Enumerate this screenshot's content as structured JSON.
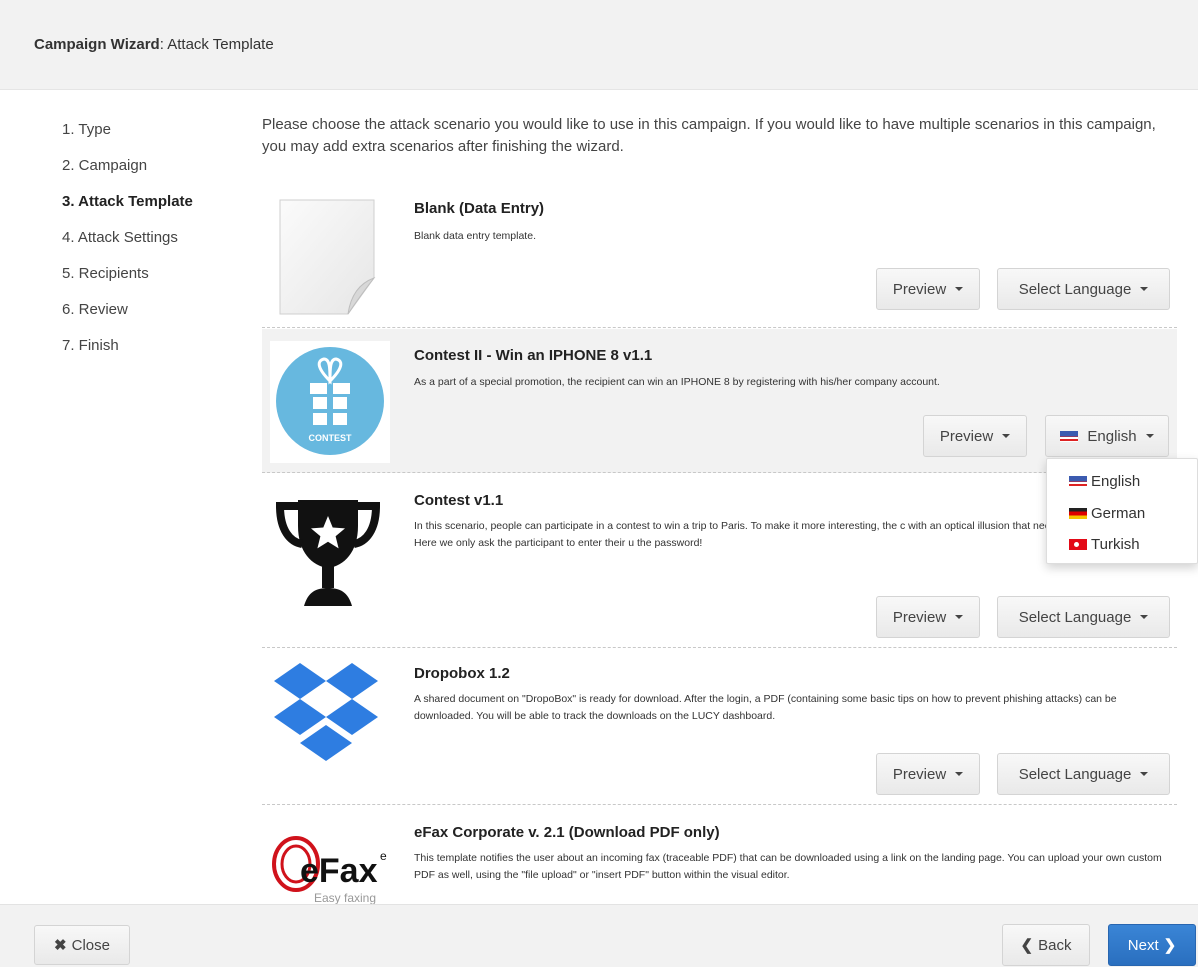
{
  "header": {
    "title_bold": "Campaign Wizard",
    "title_rest": ": Attack Template"
  },
  "steps": [
    {
      "label": "1. Type"
    },
    {
      "label": "2. Campaign"
    },
    {
      "label": "3. Attack Template",
      "active": true
    },
    {
      "label": "4. Attack Settings"
    },
    {
      "label": "5. Recipients"
    },
    {
      "label": "6. Review"
    },
    {
      "label": "7. Finish"
    }
  ],
  "intro": "Please choose the attack scenario you would like to use in this campaign. If you would like to have multiple scenarios in this campaign, you may add extra scenarios after finishing the wizard.",
  "templates": [
    {
      "name": "Blank (Data Entry)",
      "description": "Blank data entry template.",
      "preview_label": "Preview",
      "language_label": "Select Language",
      "thumb_icon": "blank-page-icon"
    },
    {
      "name": "Contest II - Win an IPHONE 8 v1.1",
      "description": "As a part of a special promotion, the recipient can win an IPHONE 8 by registering with his/her company account.",
      "preview_label": "Preview",
      "language_label": "English",
      "thumb_icon": "gift-contest-icon",
      "thumb_text": "CONTEST"
    },
    {
      "name": "Contest v1.1",
      "description": "In this scenario, people can participate in a contest to win a trip to Paris. To make it more interesting, the c with an optical illusion that needs to be solved by the user. Here we only ask the participant to enter their u the password!",
      "preview_label": "Preview",
      "language_label": "Select Language",
      "thumb_icon": "trophy-icon"
    },
    {
      "name": "Dropobox 1.2",
      "description": "A shared document on \"DropoBox\" is ready for download. After the login, a PDF (containing some basic tips on how to prevent phishing attacks) can be downloaded. You will be able to track the downloads on the LUCY dashboard.",
      "preview_label": "Preview",
      "language_label": "Select Language",
      "thumb_icon": "dropbox-icon"
    },
    {
      "name": "eFax Corporate v. 2.1 (Download PDF only)",
      "description": "This template notifies the user about an incoming fax (traceable PDF) that can be downloaded using a link on the landing page. You can upload your own custom PDF as well, using the \"file upload\" or \"insert PDF\" button within the visual editor.",
      "thumb_icon": "efax-logo-icon",
      "logo_text": "eFax",
      "logo_sup": "e",
      "logo_tagline": "Easy faxing"
    }
  ],
  "language_menu": [
    {
      "label": "English",
      "flag": "flag-en"
    },
    {
      "label": "German",
      "flag": "flag-de"
    },
    {
      "label": "Turkish",
      "flag": "flag-tr"
    }
  ],
  "footer": {
    "close_label": "Close",
    "back_label": "Back",
    "next_label": "Next"
  },
  "colors": {
    "primary": "#2a6fbf",
    "contest_blue": "#67b8df",
    "dropbox_blue": "#2e7de1",
    "efax_red": "#d0121b"
  }
}
